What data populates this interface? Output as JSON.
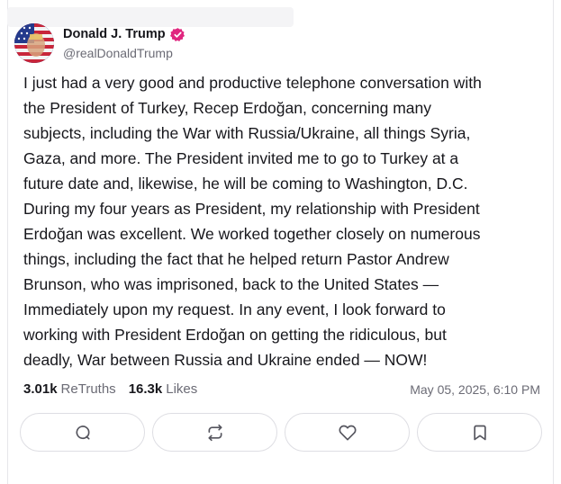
{
  "post": {
    "author": {
      "display_name": "Donald J. Trump",
      "handle": "@realDonaldTrump",
      "verified": true,
      "avatar_icon": "avatar-flag-portrait",
      "verified_icon": "verified-badge-icon"
    },
    "text": "I just had a very good and productive telephone conversation with\nthe President of Turkey, Recep Erdoğan, concerning many\nsubjects, including the War with Russia/Ukraine, all things Syria,\nGaza, and more. The President invited me to go to Turkey at a\nfuture date and, likewise, he will be coming to Washington, D.C.\nDuring my four years as President, my relationship with President\nErdoğan was excellent. We worked together closely on numerous\nthings, including the fact that he helped return Pastor Andrew\nBrunson, who was imprisoned, back to the United States —\nImmediately upon my request. In any event, I look forward to\nworking with President Erdoğan on getting the ridiculous, but\ndeadly, War between Russia and Ukraine ended — NOW!",
    "stats": {
      "retruths_count": "3.01k",
      "retruths_label": "ReTruths",
      "likes_count": "16.3k",
      "likes_label": "Likes"
    },
    "timestamp": "May 05, 2025, 6:10 PM"
  },
  "actions": [
    {
      "name": "reply",
      "icon": "comment-icon"
    },
    {
      "name": "retruth",
      "icon": "repost-icon"
    },
    {
      "name": "like",
      "icon": "heart-icon"
    },
    {
      "name": "bookmark",
      "icon": "bookmark-icon"
    }
  ],
  "colors": {
    "text": "#17171c",
    "muted": "#6b6b75",
    "verified": "#e0267f",
    "border": "#dedee3"
  }
}
